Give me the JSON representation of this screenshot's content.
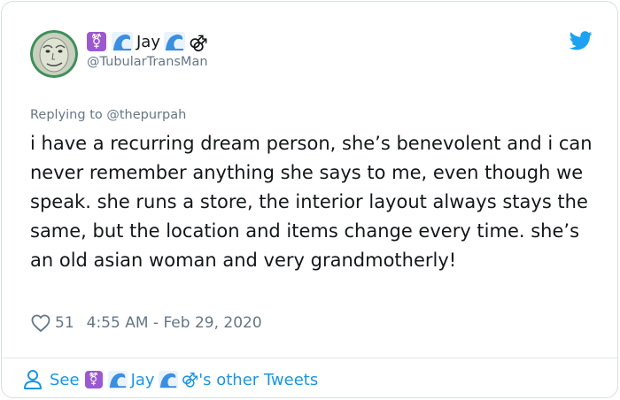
{
  "author": {
    "display_name": "Jay",
    "handle": "@TubularTransMan",
    "transgender_symbol": "⚧",
    "male_symbol": "⚣"
  },
  "reply": {
    "prefix": "Replying to",
    "target": "@thepurpah"
  },
  "tweet": {
    "text": "i have a recurring dream person, she’s benevolent and i can never remember anything she says to me, even though we speak. she runs a store, the interior layout always stays the same, but the location and items change every time. she’s an old asian woman and very grandmotherly!",
    "likes": "51",
    "timestamp": "4:55 AM - Feb 29, 2020"
  },
  "footer": {
    "see_label": "See",
    "suffix": "'s other Tweets"
  },
  "icons": {
    "avatar": "avatar-image",
    "twitter": "twitter-bird-icon",
    "heart": "heart-icon",
    "person": "person-icon",
    "wave": "wave-emoji-icon"
  },
  "colors": {
    "twitter_blue": "#1da1f2",
    "link_blue": "#1b95e0",
    "secondary_text": "#657786",
    "primary_text": "#14171a",
    "emoji_purple": "#9b59d0",
    "wave_blue": "#3b8fe0"
  }
}
